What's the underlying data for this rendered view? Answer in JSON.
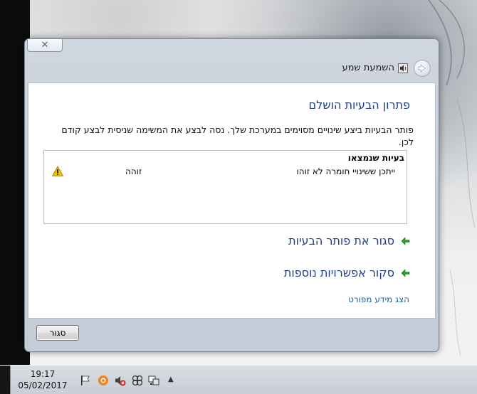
{
  "window": {
    "close_glyph": "✕",
    "nav_title": "השמעת שמע"
  },
  "content": {
    "heading": "פתרון הבעיות הושלם",
    "description": "פותר הבעיות ביצע שינויים מסוימים במערכת שלך. נסה לבצע את המשימה שניסית לבצע קודם לכן.",
    "problems": {
      "header": "בעיות שנמצאו",
      "rows": [
        {
          "name": "ייתכן ששינויי חומרה לא זוהו",
          "status": "זוהה",
          "icon": "warning-icon"
        }
      ]
    },
    "links": {
      "close_troubleshooter": "סגור את פותר הבעיות",
      "explore_options": "סקור אפשרויות נוספות",
      "details": "הצג מידע מפורט"
    },
    "close_button": "סגור"
  },
  "taskbar": {
    "time": "19:17",
    "date": "05/02/2017",
    "tray_chevron": "▲",
    "tray_icons": [
      "action-center-flag-icon",
      "avast-icon",
      "volume-muted-icon",
      "network-icon",
      "device-icon"
    ]
  },
  "colors": {
    "heading": "#1f3d8e",
    "link_arrow": "#2aa02a",
    "warning": "#f2c200"
  }
}
